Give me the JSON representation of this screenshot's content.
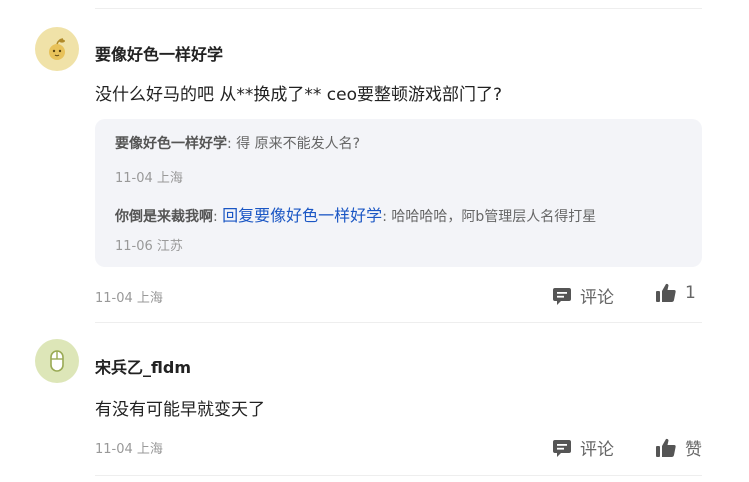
{
  "comments": [
    {
      "username": "要像好色一样好学",
      "avatar_bg": "#f0e2a8",
      "content": "没什么好马的吧 从**换成了** ceo要整顿游戏部门了?",
      "replies": [
        {
          "user": "要像好色一样好学",
          "sep": ":",
          "text": " 得 原来不能发人名?",
          "meta": "11-04 上海"
        },
        {
          "user": "你倒是来裁我啊",
          "sep": ":",
          "reply_to": "回复要像好色一样好学",
          "sep2": ":",
          "text": " 哈哈哈哈，阿b管理层人名得打星",
          "meta": "11-06 江苏"
        }
      ],
      "meta": "11-04 上海",
      "comment_label": "评论",
      "like_label": "1"
    },
    {
      "username": "宋兵乙_fldm",
      "avatar_bg": "#dde6b8",
      "content": "有没有可能早就变天了",
      "meta": "11-04 上海",
      "comment_label": "评论",
      "like_label": "赞"
    }
  ],
  "icons": {
    "comment": "comment-icon",
    "like": "thumbs-up-icon"
  },
  "colors": {
    "link": "#1a56c4",
    "reply_bg": "#f3f4f8",
    "meta": "#999999"
  }
}
